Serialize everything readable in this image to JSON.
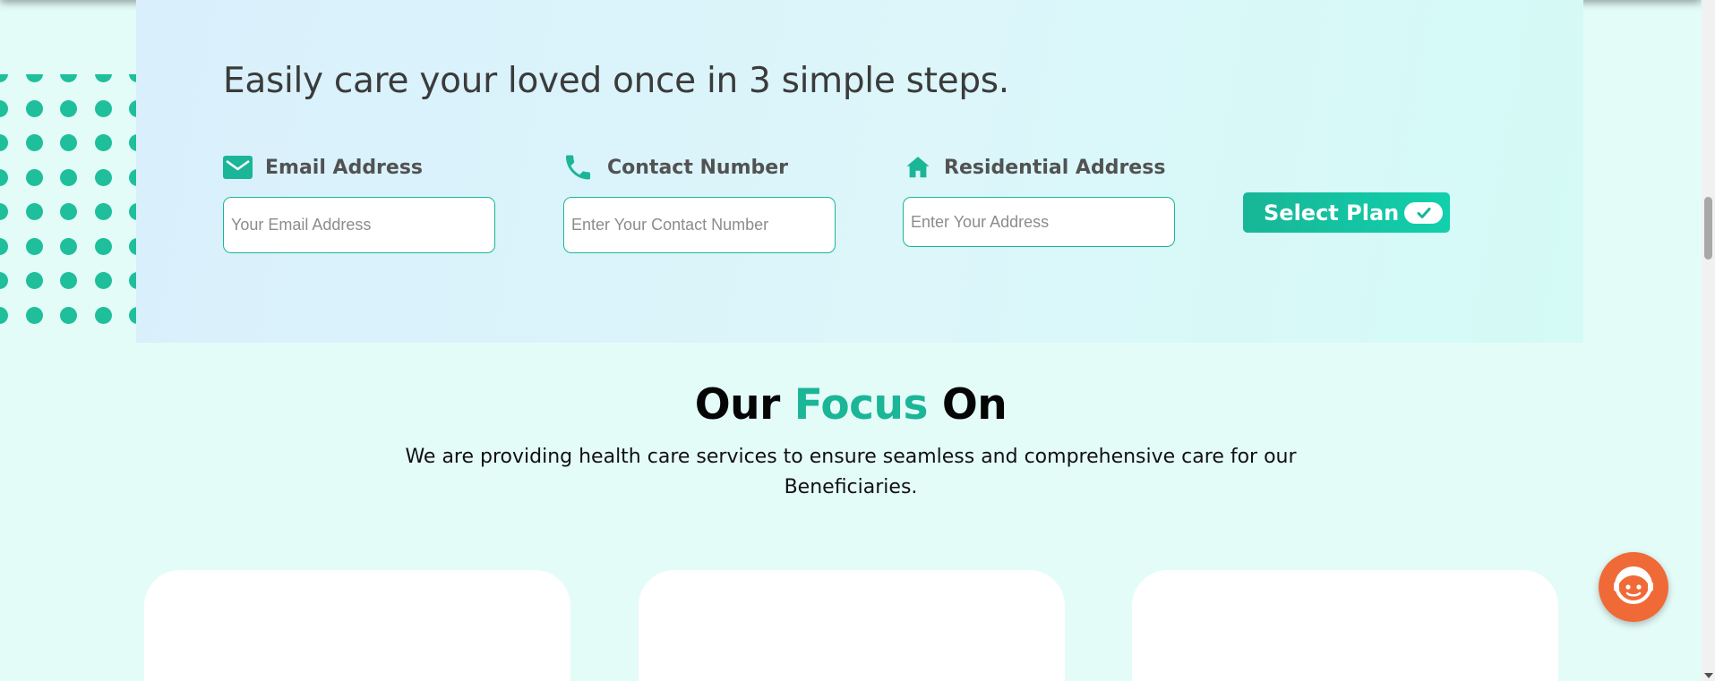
{
  "steps": {
    "title": "Easily care your loved once in 3 simple steps.",
    "email_label": "Email Address",
    "email_placeholder": "Your Email Address",
    "contact_label": "Contact Number",
    "contact_placeholder": "Enter Your Contact Number",
    "address_label": "Residential Address",
    "address_placeholder": "Enter Your Address",
    "select_plan_label": "Select Plan"
  },
  "focus": {
    "title_part1": "Our ",
    "title_accent": "Focus",
    "title_part2": " On",
    "description": "We are providing  health care services to ensure seamless and comprehensive care for our Beneficiaries."
  },
  "icons": {
    "email": "envelope-icon",
    "contact": "phone-icon",
    "address": "home-icon",
    "select_plan": "check-icon",
    "chat": "support-agent-icon"
  },
  "colors": {
    "accent": "#1bb597",
    "chat_widget": "#f06a38",
    "page_background": "#e4fcf8"
  }
}
